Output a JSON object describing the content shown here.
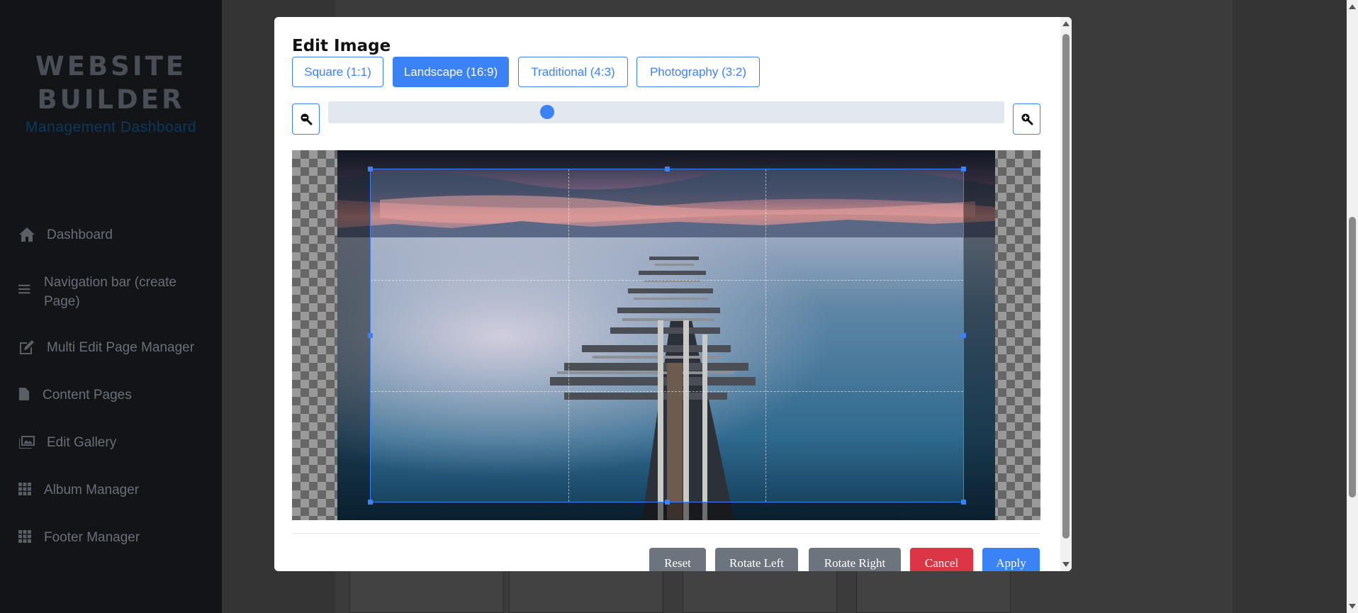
{
  "sidebar": {
    "brand_line1": "WEBSITE",
    "brand_line2": "BUILDER",
    "subtitle": "Management Dashboard",
    "items": [
      {
        "label": "Dashboard",
        "icon": "home-icon"
      },
      {
        "label": "Navigation bar (create Page)",
        "icon": "bars-icon"
      },
      {
        "label": "Multi Edit Page Manager",
        "icon": "edit-icon"
      },
      {
        "label": "Content Pages",
        "icon": "file-icon"
      },
      {
        "label": "Edit Gallery",
        "icon": "images-icon"
      },
      {
        "label": "Album Manager",
        "icon": "grid-icon"
      },
      {
        "label": "Footer Manager",
        "icon": "grid-icon"
      }
    ]
  },
  "modal": {
    "title": "Edit Image",
    "ratios": [
      {
        "label": "Square (1:1)",
        "active": false
      },
      {
        "label": "Landscape (16:9)",
        "active": true
      },
      {
        "label": "Traditional (4:3)",
        "active": false
      },
      {
        "label": "Photography (3:2)",
        "active": false
      }
    ],
    "zoom": {
      "level": 0.32,
      "zoom_out_icon": "zoom-out-icon",
      "zoom_in_icon": "zoom-in-icon"
    },
    "actions": {
      "reset": "Reset",
      "rotate_left": "Rotate Left",
      "rotate_right": "Rotate Right",
      "cancel": "Cancel",
      "apply": "Apply"
    }
  },
  "colors": {
    "accent": "#3b82f6",
    "danger": "#dc3545",
    "secondary": "#6c757d",
    "sidebar_bg": "#121417"
  }
}
